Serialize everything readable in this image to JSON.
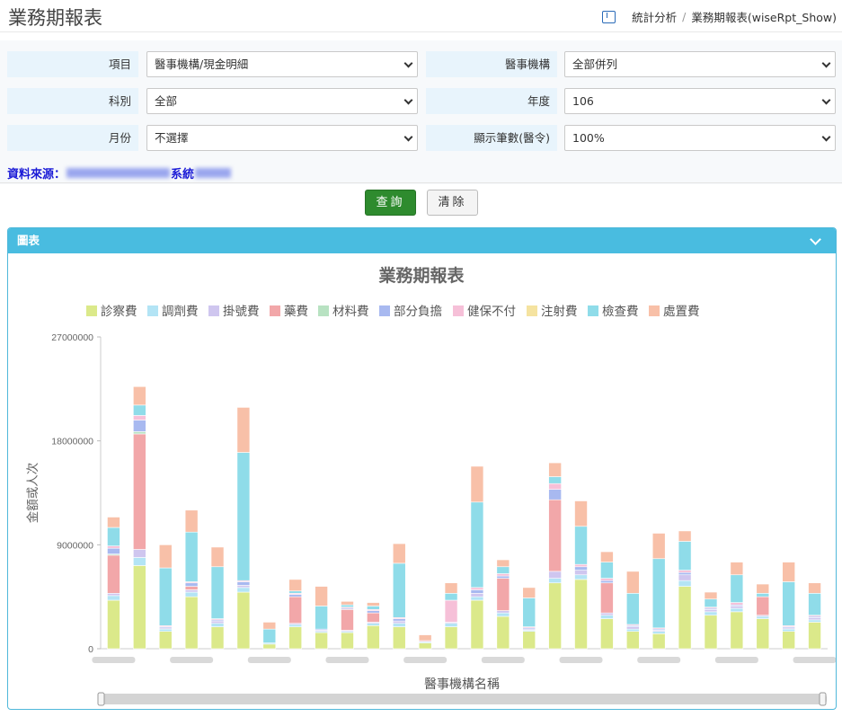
{
  "header": {
    "title": "業務期報表",
    "breadcrumb": [
      "統計分析",
      "業務期報表(wiseRpt_Show)"
    ]
  },
  "form": {
    "fields": [
      {
        "label": "項目",
        "value": "醫事機構/現金明細"
      },
      {
        "label": "醫事機構",
        "value": "全部併列"
      },
      {
        "label": "科別",
        "value": "全部"
      },
      {
        "label": "年度",
        "value": "106"
      },
      {
        "label": "月份",
        "value": "不選擇"
      },
      {
        "label": "顯示筆數(醫令)",
        "value": "100%"
      }
    ]
  },
  "source": {
    "label": "資料來源：",
    "value_suffix": "系統"
  },
  "buttons": {
    "query": "查詢",
    "clear": "清除"
  },
  "panel": {
    "title": "圖表"
  },
  "colors": {
    "panel_header": "#49bce0",
    "query_button": "#2e8b2e",
    "source_text": "#1a1ad6"
  },
  "chart_data": {
    "type": "bar",
    "stacked": true,
    "title": "業務期報表",
    "xlabel": "醫事機構名稱",
    "ylabel": "金額或人次",
    "ylim": [
      0,
      27000000
    ],
    "yticks": [
      0,
      9000000,
      18000000,
      27000000
    ],
    "ytick_labels": [
      "0",
      "9000000",
      "18000000",
      "27000000"
    ],
    "legend_position": "top",
    "category_labels_blurred": true,
    "num_categories": 28,
    "series": [
      {
        "name": "診察費",
        "color": "#dbe98a",
        "values": [
          4200000,
          7200000,
          1500000,
          4500000,
          1900000,
          4900000,
          400000,
          1900000,
          1400000,
          1400000,
          2000000,
          1900000,
          500000,
          1900000,
          4200000,
          2800000,
          1500000,
          5700000,
          6000000,
          2600000,
          1500000,
          1300000,
          5400000,
          2900000,
          3200000,
          2600000,
          1500000,
          2300000
        ]
      },
      {
        "name": "調劑費",
        "color": "#b3e4f5",
        "values": [
          400000,
          700000,
          200000,
          400000,
          300000,
          400000,
          100000,
          200000,
          100000,
          100000,
          200000,
          300000,
          100000,
          300000,
          300000,
          300000,
          100000,
          400000,
          400000,
          300000,
          200000,
          200000,
          500000,
          300000,
          300000,
          200000,
          200000,
          200000
        ]
      },
      {
        "name": "掛號費",
        "color": "#cfc6ef",
        "values": [
          200000,
          700000,
          100000,
          200000,
          200000,
          200000,
          0,
          100000,
          100000,
          100000,
          100000,
          200000,
          0,
          100000,
          300000,
          200000,
          100000,
          600000,
          400000,
          200000,
          200000,
          100000,
          500000,
          200000,
          200000,
          100000,
          100000,
          200000
        ]
      },
      {
        "name": "藥費",
        "color": "#f2a7a9",
        "values": [
          3300000,
          10000000,
          0,
          300000,
          0,
          0,
          0,
          2300000,
          0,
          1800000,
          800000,
          0,
          0,
          0,
          0,
          2800000,
          0,
          6200000,
          0,
          2600000,
          0,
          0,
          0,
          0,
          0,
          1600000,
          0,
          0
        ]
      },
      {
        "name": "材料費",
        "color": "#b8e2c2",
        "values": [
          100000,
          200000,
          0,
          0,
          0,
          0,
          0,
          0,
          0,
          0,
          0,
          0,
          0,
          0,
          0,
          0,
          0,
          0,
          0,
          0,
          0,
          0,
          0,
          0,
          0,
          0,
          0,
          0
        ]
      },
      {
        "name": "部分負擔",
        "color": "#a8b9f0",
        "values": [
          500000,
          1000000,
          100000,
          300000,
          100000,
          300000,
          0,
          200000,
          100000,
          100000,
          200000,
          200000,
          0,
          0,
          300000,
          200000,
          100000,
          900000,
          300000,
          200000,
          100000,
          100000,
          200000,
          100000,
          100000,
          0,
          100000,
          100000
        ]
      },
      {
        "name": "健保不付",
        "color": "#f6c0d8",
        "values": [
          200000,
          400000,
          100000,
          100000,
          100000,
          100000,
          0,
          100000,
          0,
          100000,
          100000,
          100000,
          100000,
          1900000,
          200000,
          200000,
          100000,
          500000,
          200000,
          200000,
          100000,
          100000,
          200000,
          100000,
          200000,
          0,
          100000,
          100000
        ]
      },
      {
        "name": "注射費",
        "color": "#f5e3a0",
        "values": [
          0,
          0,
          0,
          0,
          0,
          0,
          0,
          0,
          0,
          0,
          0,
          0,
          0,
          0,
          0,
          0,
          0,
          0,
          0,
          0,
          0,
          0,
          0,
          0,
          0,
          0,
          0,
          0
        ]
      },
      {
        "name": "檢查費",
        "color": "#8fdce9",
        "values": [
          1600000,
          900000,
          5000000,
          4300000,
          4500000,
          11100000,
          1200000,
          200000,
          2000000,
          200000,
          300000,
          4700000,
          0,
          600000,
          7400000,
          600000,
          2500000,
          600000,
          3300000,
          1400000,
          2700000,
          6000000,
          2500000,
          700000,
          2400000,
          300000,
          3800000,
          1900000
        ]
      },
      {
        "name": "處置費",
        "color": "#f8c0a8",
        "values": [
          900000,
          1600000,
          2000000,
          1900000,
          1700000,
          3900000,
          600000,
          1000000,
          1700000,
          300000,
          300000,
          1700000,
          500000,
          900000,
          3100000,
          600000,
          900000,
          1200000,
          2200000,
          900000,
          1900000,
          2200000,
          900000,
          600000,
          1100000,
          800000,
          1700000,
          900000
        ]
      }
    ]
  }
}
